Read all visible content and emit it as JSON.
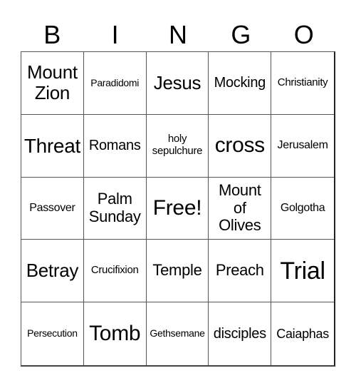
{
  "header": [
    "B",
    "I",
    "N",
    "G",
    "O"
  ],
  "cells": [
    "Mount\nZion",
    "Paradidomi",
    "Jesus",
    "Mocking",
    "Christianity",
    "Threat",
    "Romans",
    "holy\nsepulchure",
    "cross",
    "Jerusalem",
    "Passover",
    "Palm\nSunday",
    "Free!",
    "Mount\nof\nOlives",
    "Golgotha",
    "Betray",
    "Crucifixion",
    "Temple",
    "Preach",
    "Trial",
    "Persecution",
    "Tomb",
    "Gethsemane",
    "disciples",
    "Caiaphas"
  ]
}
